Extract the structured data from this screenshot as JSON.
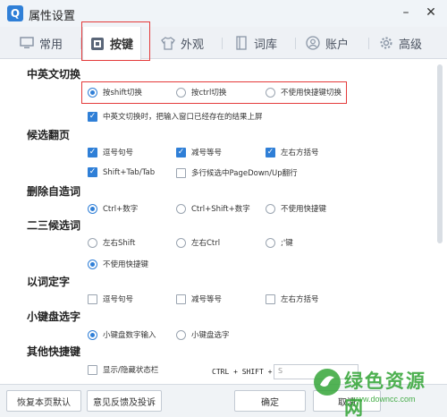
{
  "window": {
    "title": "属性设置",
    "logo": "Q"
  },
  "tabs": [
    {
      "label": "常用",
      "icon": "monitor-icon"
    },
    {
      "label": "按键",
      "icon": "keyboard-icon"
    },
    {
      "label": "外观",
      "icon": "shirt-icon"
    },
    {
      "label": "词库",
      "icon": "book-icon"
    },
    {
      "label": "账户",
      "icon": "user-icon"
    },
    {
      "label": "高级",
      "icon": "gear-icon"
    }
  ],
  "sections": {
    "cn_en_switch": {
      "title": "中英文切换",
      "options": [
        "按shift切换",
        "按ctrl切换",
        "不使用快捷键切换"
      ],
      "selected": "按shift切换",
      "checkbox": "中英文切换时，把输入窗口已经存在的结果上屏"
    },
    "candidate_page": {
      "title": "候选翻页",
      "options": [
        {
          "label": "逗号句号",
          "checked": true
        },
        {
          "label": "减号等号",
          "checked": true
        },
        {
          "label": "左右方括号",
          "checked": true
        },
        {
          "label": "Shift+Tab/Tab",
          "checked": true
        },
        {
          "label": "多行候选中PageDown/Up翻行",
          "checked": false
        }
      ]
    },
    "delete_word": {
      "title": "删除自造词",
      "options": [
        "Ctrl+数字",
        "Ctrl+Shift+数字",
        "不使用快捷键"
      ],
      "selected": "Ctrl+数字"
    },
    "second_third": {
      "title": "二三候选词",
      "options": [
        "左右Shift",
        "左右Ctrl",
        ";'键",
        "不使用快捷键"
      ],
      "selected": "不使用快捷键"
    },
    "word_to_char": {
      "title": "以词定字",
      "options": [
        {
          "label": "逗号句号",
          "checked": false
        },
        {
          "label": "减号等号",
          "checked": false
        },
        {
          "label": "左右方括号",
          "checked": false
        }
      ]
    },
    "numpad": {
      "title": "小键盘选字",
      "options": [
        "小键盘数字输入",
        "小键盘选字"
      ],
      "selected": "小键盘数字输入"
    },
    "other_shortcuts": {
      "title": "其他快捷键",
      "checkbox": "显示/隐藏状态栏",
      "key_label": "CTRL + SHIFT +",
      "key_value": "S"
    }
  },
  "footer": {
    "restore_label": "恢复本页默认",
    "feedback_label": "意见反馈及投诉",
    "ok_label": "确定",
    "cancel_label": "取消"
  },
  "watermark": {
    "line1": "绿色资源网",
    "line2": "www.downcc.com"
  },
  "colors": {
    "accent": "#2f7fd7",
    "highlight": "#e43a3a",
    "watermark": "#35a638"
  }
}
